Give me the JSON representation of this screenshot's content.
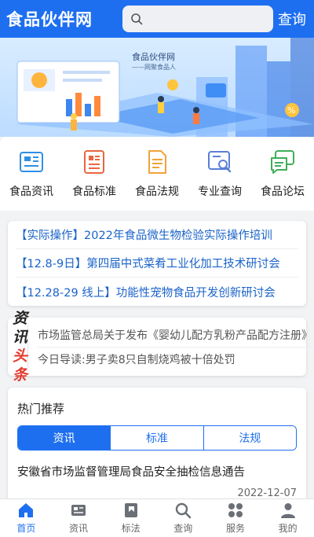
{
  "header": {
    "title": "食品伙伴网",
    "search_placeholder": "",
    "search_button": "查询"
  },
  "banner": {
    "brand": "食品伙伴网",
    "slogan": "——网聚食品人"
  },
  "quick_nav": [
    {
      "label": "食品资讯",
      "icon": "news-card-icon",
      "color": "#2f8fe3"
    },
    {
      "label": "食品标准",
      "icon": "standard-doc-icon",
      "color": "#e8663f"
    },
    {
      "label": "食品法规",
      "icon": "regulation-doc-icon",
      "color": "#f2a23a"
    },
    {
      "label": "专业查询",
      "icon": "search-doc-icon",
      "color": "#5a7fd8"
    },
    {
      "label": "食品论坛",
      "icon": "forum-chat-icon",
      "color": "#3fae5a"
    }
  ],
  "headlines": [
    "【实际操作】2022年食品微生物检验实际操作培训",
    "【12.8-9日】第四届中式菜肴工业化加工技术研讨会",
    "【12.28-29 线上】功能性宠物食品开发创新研讨会"
  ],
  "toutiao": {
    "logo_line1": "资讯",
    "logo_line2": "头条",
    "items": [
      "市场监管总局关于发布《婴幼儿配方乳粉产品配方注册》",
      "今日导读:男子卖8只自制烧鸡被十倍处罚"
    ]
  },
  "hot": {
    "title": "热门推荐",
    "tabs": [
      "资讯",
      "标准",
      "法规"
    ],
    "active_tab": 0,
    "article_title": "安徽省市场监督管理局食品安全抽检信息通告",
    "article_date": "2022-12-07"
  },
  "tabbar": [
    {
      "label": "首页",
      "icon": "home-icon"
    },
    {
      "label": "资讯",
      "icon": "news-icon"
    },
    {
      "label": "标法",
      "icon": "book-icon"
    },
    {
      "label": "查询",
      "icon": "search-icon"
    },
    {
      "label": "服务",
      "icon": "grid-services-icon"
    },
    {
      "label": "我的",
      "icon": "user-icon"
    }
  ],
  "colors": {
    "primary": "#1e6ff0",
    "headline_text": "#1a63c9",
    "toutiao_red": "#e33b2e"
  }
}
